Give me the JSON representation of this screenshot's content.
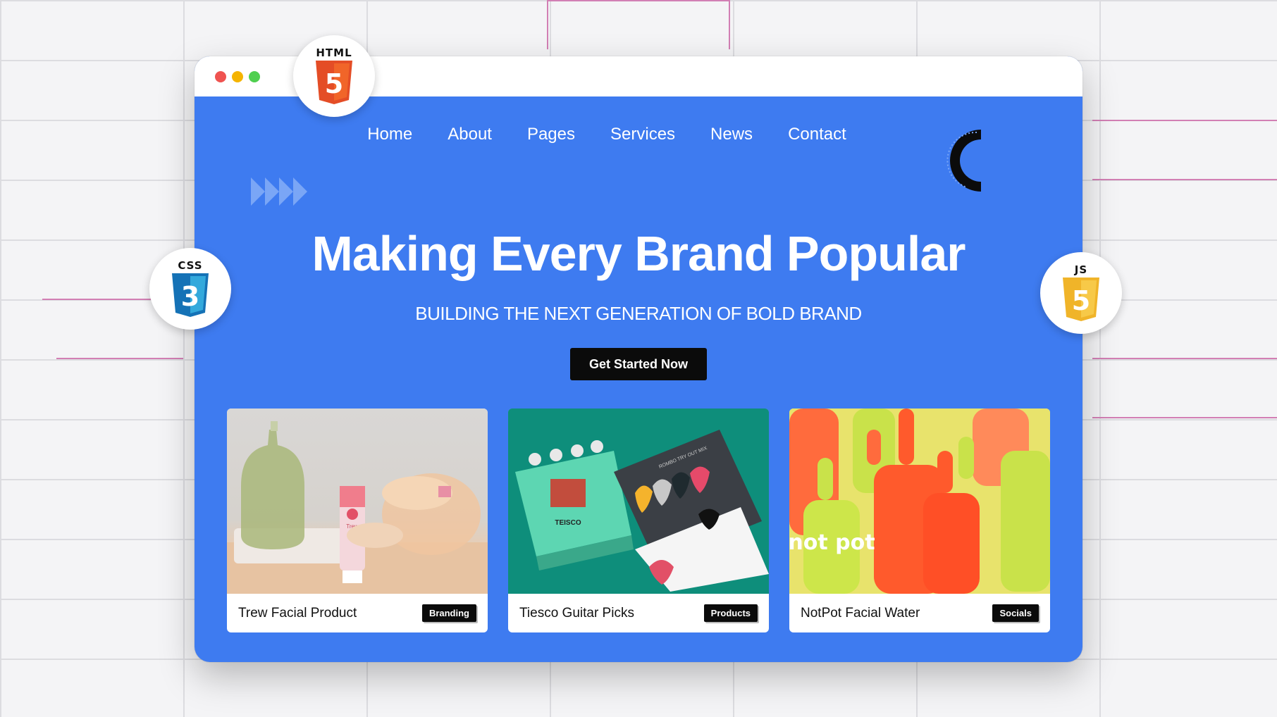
{
  "nav": {
    "items": [
      "Home",
      "About",
      "Pages",
      "Services",
      "News",
      "Contact"
    ]
  },
  "hero": {
    "title": "Making Every Brand Popular",
    "subtitle": "BUILDING THE NEXT GENERATION OF BOLD BRAND",
    "cta_label": "Get Started Now"
  },
  "cards": [
    {
      "title": "Trew Facial Product",
      "badge": "Branding"
    },
    {
      "title": "Tiesco Guitar Picks",
      "badge": "Products"
    },
    {
      "title": "NotPot Facial Water",
      "badge": "Socials"
    }
  ],
  "tech_badges": {
    "html": {
      "label": "HTML",
      "number": "5",
      "color": "#e44d26",
      "icon": "html5-icon"
    },
    "css": {
      "label": "CSS",
      "number": "3",
      "color": "#1572b6",
      "icon": "css3-icon"
    },
    "js": {
      "label": "JS",
      "number": "5",
      "color": "#f0b429",
      "icon": "js-icon"
    }
  },
  "product_image_text": {
    "tube_brand": "Trew",
    "pedal_brand": "TEISCO",
    "picks_card": "ROMBO TRY OUT MIX",
    "bottle_text": "not pot"
  },
  "colors": {
    "accent": "#3e7bf0",
    "cta_bg": "#0b0b0b",
    "dot_red": "#ef5350",
    "dot_yellow": "#f5b400",
    "dot_green": "#4fcf4f"
  }
}
